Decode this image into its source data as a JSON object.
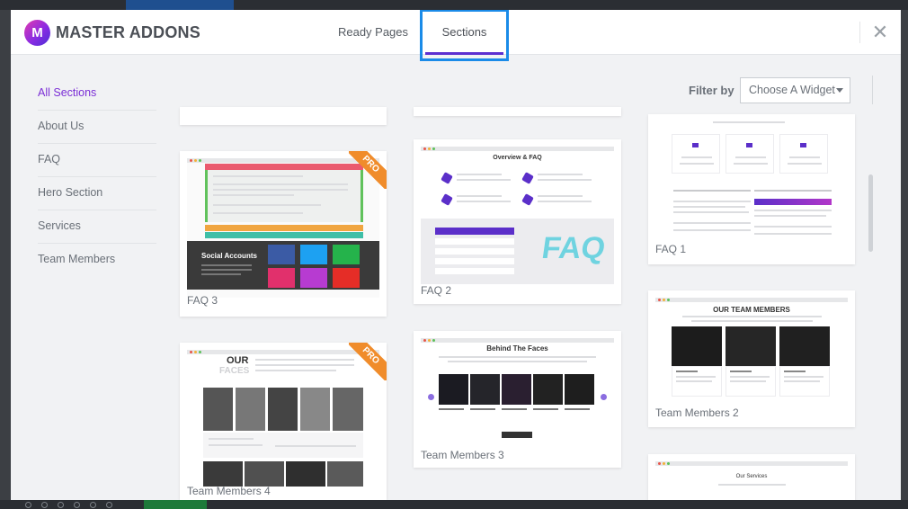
{
  "app": {
    "brand": "MASTER ADDONS",
    "logo_letter": "M"
  },
  "tabs": [
    {
      "label": "Ready Pages",
      "active": false
    },
    {
      "label": "Sections",
      "active": true
    }
  ],
  "sidebar": {
    "items": [
      {
        "label": "All Sections",
        "active": true
      },
      {
        "label": "About Us"
      },
      {
        "label": "FAQ"
      },
      {
        "label": "Hero Section"
      },
      {
        "label": "Services"
      },
      {
        "label": "Team Members"
      }
    ]
  },
  "filter": {
    "label": "Filter by",
    "selected": "Choose A Widget"
  },
  "cards": {
    "faq3": {
      "label": "FAQ 3",
      "badge": "PRO",
      "thumb_heading": "Social Accounts"
    },
    "faq2": {
      "label": "FAQ 2",
      "thumb_heading": "Overview & FAQ",
      "thumb_art": "FAQ"
    },
    "faq1": {
      "label": "FAQ 1"
    },
    "team4": {
      "label": "Team Members 4",
      "badge": "PRO",
      "thumb_heading": "OUR",
      "thumb_heading2": "FACES"
    },
    "team3": {
      "label": "Team Members 3",
      "thumb_heading": "Behind The Faces"
    },
    "team2": {
      "label": "Team Members 2",
      "thumb_heading": "OUR TEAM MEMBERS"
    },
    "services": {
      "thumb_heading": "Our Services"
    }
  },
  "colors": {
    "accent": "#7b2fd6",
    "tab_underline": "#5c2fd0",
    "highlight": "#1a8be8",
    "pro_badge": "#f08c2b"
  },
  "icons": {
    "close": "close-icon",
    "dropdown": "chevron-down-icon"
  }
}
